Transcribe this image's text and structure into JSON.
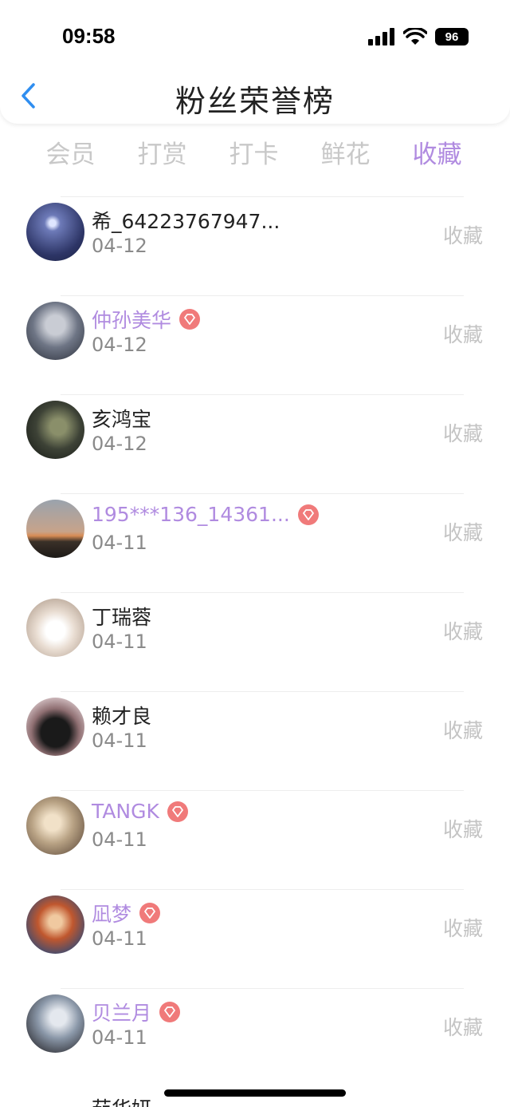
{
  "status_bar": {
    "time": "09:58",
    "battery": "96"
  },
  "header": {
    "title": "粉丝荣誉榜"
  },
  "tabs": [
    {
      "label": "会员",
      "active": false
    },
    {
      "label": "打赏",
      "active": false
    },
    {
      "label": "打卡",
      "active": false
    },
    {
      "label": "鲜花",
      "active": false
    },
    {
      "label": "收藏",
      "active": true
    }
  ],
  "rows": [
    {
      "name": "希_64223767947...",
      "date": "04-12",
      "action": "收藏",
      "vip": false
    },
    {
      "name": "仲孙美华",
      "date": "04-12",
      "action": "收藏",
      "vip": true
    },
    {
      "name": "亥鸿宝",
      "date": "04-12",
      "action": "收藏",
      "vip": false
    },
    {
      "name": "195***136_14361...",
      "date": "04-11",
      "action": "收藏",
      "vip": true
    },
    {
      "name": "丁瑞蓉",
      "date": "04-11",
      "action": "收藏",
      "vip": false
    },
    {
      "name": "赖才良",
      "date": "04-11",
      "action": "收藏",
      "vip": false
    },
    {
      "name": "TANGK",
      "date": "04-11",
      "action": "收藏",
      "vip": true
    },
    {
      "name": "凪梦",
      "date": "04-11",
      "action": "收藏",
      "vip": true
    },
    {
      "name": "贝兰月",
      "date": "04-11",
      "action": "收藏",
      "vip": true
    }
  ],
  "peek_row": {
    "name": "茹华妍"
  },
  "colors": {
    "accent": "#b08be0",
    "badge": "#f07a7a",
    "back_arrow": "#2f8ef0"
  }
}
